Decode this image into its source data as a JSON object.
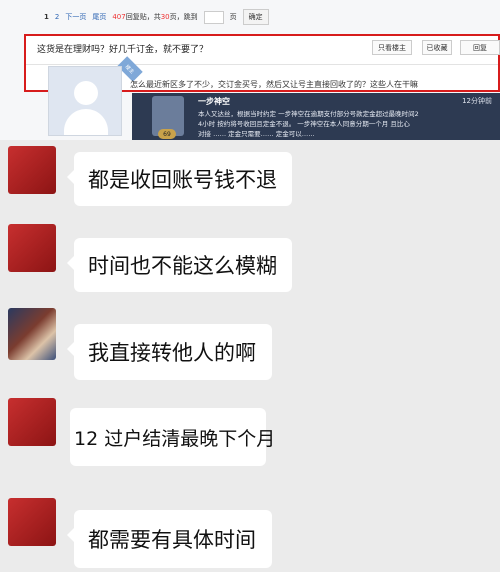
{
  "forum": {
    "pager": {
      "pages": [
        "1",
        "2"
      ],
      "next": "下一页",
      "last": "尾页",
      "reply_count": "407",
      "reply_suffix": "回复贴，共",
      "page_count": "30",
      "page_suffix": "页，跳到",
      "page_unit": "页",
      "confirm": "确定"
    },
    "thread": {
      "title": "这货是在理财吗？好几千订金，就不要了？",
      "buttons": [
        "只看楼主",
        "已收藏",
        "回复"
      ],
      "floor_tag": "楼主"
    },
    "post": {
      "text": "怎么最近新区多了不少，交订金买号，然后又让号主直接回收了的？这些人在干嘛"
    },
    "game_screenshot": {
      "name": "一步神空",
      "time": "12分钟前",
      "level": "69",
      "lines": [
        "本人又达丝，根据当时约定 一步神空在逾期支付部分号款定金超过最晚时间2",
        "4小时 按约将号收回且定金不退。 一步神空在本人同意分期一个月 且比心",
        "对接 …… 定金只需要…… 定金可以……"
      ]
    }
  },
  "chat": {
    "messages": [
      {
        "text": "都是收回账号钱不退"
      },
      {
        "text": "时间也不能这么模糊"
      },
      {
        "text": "我直接转他人的啊"
      },
      {
        "text": "12  过户结清最晚下个月"
      },
      {
        "text": "都需要有具体时间"
      }
    ]
  },
  "colors": {
    "highlight_border": "#d71c1c",
    "chat_background": "#ebebeb",
    "bubble": "#ffffff",
    "link": "#2d64b3"
  }
}
